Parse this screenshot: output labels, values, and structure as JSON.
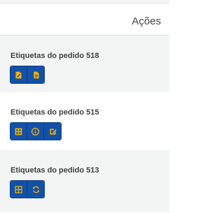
{
  "header": {
    "title": "Ações"
  },
  "rows": [
    {
      "label": "Etiquetas do pedido 518",
      "buttons": [
        {
          "icon": "edit-document-icon"
        },
        {
          "icon": "document-icon"
        }
      ]
    },
    {
      "label": "Etiquetas do pedido 515",
      "buttons": [
        {
          "icon": "table-icon"
        },
        {
          "icon": "info-icon"
        },
        {
          "icon": "edit-icon"
        }
      ]
    },
    {
      "label": "Etiquetas do pedido 513",
      "buttons": [
        {
          "icon": "grid-icon"
        },
        {
          "icon": "refresh-icon"
        }
      ]
    }
  ],
  "colors": {
    "button_bg": "#1351a8",
    "icon": "#f4b400",
    "shaded_row": "#f3f5f5"
  }
}
